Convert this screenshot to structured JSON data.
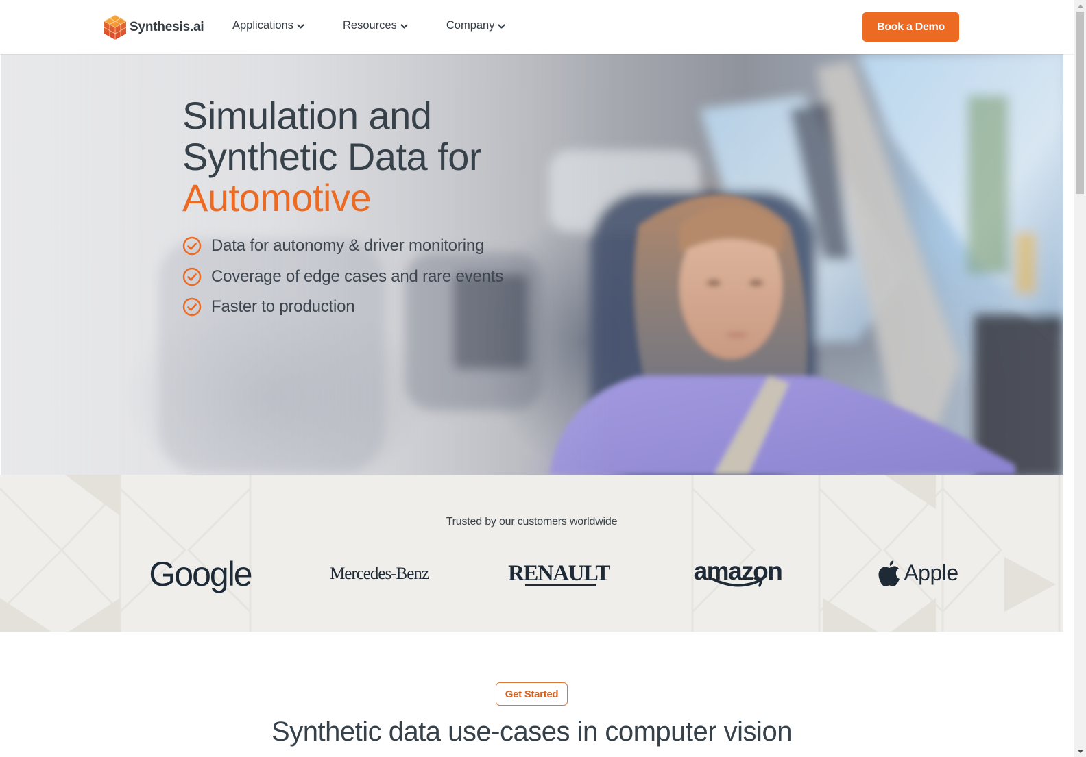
{
  "nav": {
    "brand_name": "Synthesis.ai",
    "menu": [
      {
        "label": "Applications",
        "icon": "chevron-down-icon"
      },
      {
        "label": "Resources",
        "icon": "chevron-down-icon"
      },
      {
        "label": "Company",
        "icon": "chevron-down-icon"
      }
    ],
    "cta_label": "Book a Demo"
  },
  "hero": {
    "title_line1": "Simulation and",
    "title_line2": "Synthetic Data for",
    "title_accent": "Automotive",
    "features": [
      {
        "icon": "check-circle-icon",
        "label": "Data for autonomy & driver monitoring"
      },
      {
        "icon": "check-circle-icon",
        "label": "Coverage of edge cases and rare events"
      },
      {
        "icon": "check-circle-icon",
        "label": "Faster to production"
      }
    ],
    "image_description": "Synthetic woman driver seated in car interior"
  },
  "trusted": {
    "label": "Trusted by our customers worldwide",
    "logos": [
      "Google",
      "Mercedes-Benz",
      "RENAULT",
      "amazon",
      "Apple"
    ]
  },
  "use_cases": {
    "badge_label": "Get Started",
    "title": "Synthetic data use-cases in computer vision"
  },
  "colors": {
    "accent": "#ec6a22",
    "text_dark": "#37414a",
    "band_bg": "#efeeea",
    "logo_color": "#1f2a37"
  }
}
